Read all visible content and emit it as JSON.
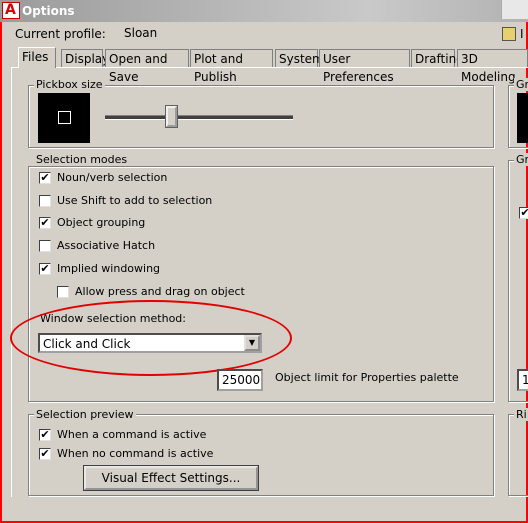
{
  "window": {
    "title": "Options"
  },
  "header": {
    "profile_label": "Current profile:",
    "profile_value": "Sloan",
    "drawing_label_fragment": "I"
  },
  "tabs": [
    {
      "label": "Files",
      "active": true
    },
    {
      "label": "Display"
    },
    {
      "label": "Open and Save"
    },
    {
      "label": "Plot and Publish"
    },
    {
      "label": "System"
    },
    {
      "label": "User Preferences"
    },
    {
      "label": "Drafting"
    },
    {
      "label": "3D Modeling"
    }
  ],
  "pickbox": {
    "title": "Pickbox size",
    "slider_level": 0.32
  },
  "selection_modes": {
    "title": "Selection modes",
    "options": [
      {
        "label": "Noun/verb selection",
        "checked": true
      },
      {
        "label": "Use Shift to add to selection",
        "checked": false
      },
      {
        "label": "Object grouping",
        "checked": true
      },
      {
        "label": "Associative Hatch",
        "checked": false
      },
      {
        "label": "Implied windowing",
        "checked": true
      },
      {
        "label": "Allow press and drag on object",
        "checked": false
      }
    ],
    "window_method_label": "Window selection method:",
    "window_method_value": "Click and Click",
    "object_limit_value": "25000",
    "object_limit_label": "Object limit for Properties palette"
  },
  "selection_preview": {
    "title": "Selection preview",
    "options": [
      {
        "label": "When a command is active",
        "checked": true
      },
      {
        "label": "When no command is active",
        "checked": true
      }
    ],
    "button_label": "Visual Effect Settings..."
  },
  "right_column_fragments": {
    "grips_size": "Gr",
    "grips": "Gr",
    "ribbon": "Ri",
    "limit_fragment": "1"
  },
  "colors": {
    "annotation": "#e30000",
    "window_border": "#ff0000",
    "background": "#d4d0c8"
  },
  "icons": {
    "app": "autocad-app-icon",
    "profile": "profile-icon",
    "check": "✔",
    "dropdown": "▼"
  }
}
